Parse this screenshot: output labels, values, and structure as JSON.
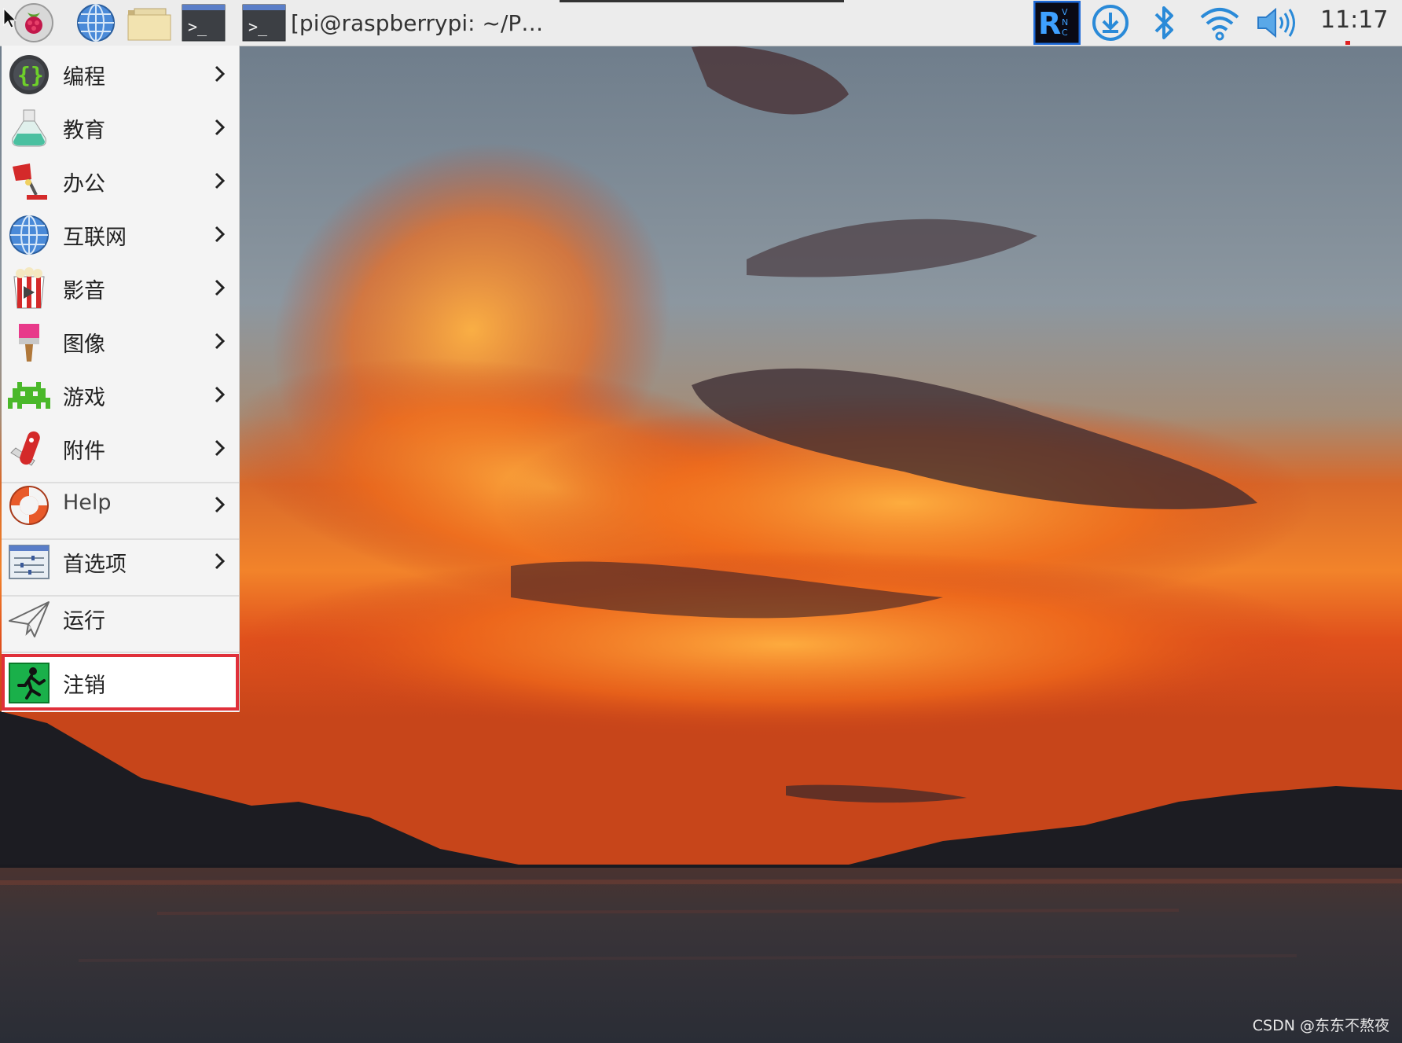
{
  "taskbar": {
    "window_title": "[pi@raspberrypi: ~/P…",
    "clock": "11:17",
    "icons": [
      "raspberry-menu-icon",
      "web-browser-icon",
      "file-manager-icon",
      "terminal-icon",
      "vnc-icon",
      "update-icon",
      "bluetooth-icon",
      "wifi-icon",
      "volume-icon"
    ]
  },
  "menu": {
    "items": [
      {
        "label": "编程",
        "icon": "programming-icon"
      },
      {
        "label": "教育",
        "icon": "education-icon"
      },
      {
        "label": "办公",
        "icon": "office-icon"
      },
      {
        "label": "互联网",
        "icon": "internet-icon"
      },
      {
        "label": "影音",
        "icon": "sound-video-icon"
      },
      {
        "label": "图像",
        "icon": "graphics-icon"
      },
      {
        "label": "游戏",
        "icon": "games-icon"
      },
      {
        "label": "附件",
        "icon": "accessories-icon"
      },
      {
        "label": "Help",
        "icon": "help-icon"
      },
      {
        "label": "首选项",
        "icon": "preferences-icon"
      },
      {
        "label": "运行",
        "icon": "run-icon"
      },
      {
        "label": "注销",
        "icon": "logout-icon"
      }
    ]
  },
  "watermark": "CSDN @东东不熬夜",
  "colors": {
    "taskbar_bg": "#ececec",
    "menu_bg": "#f4f4f4",
    "highlight_border": "#e0303a"
  }
}
